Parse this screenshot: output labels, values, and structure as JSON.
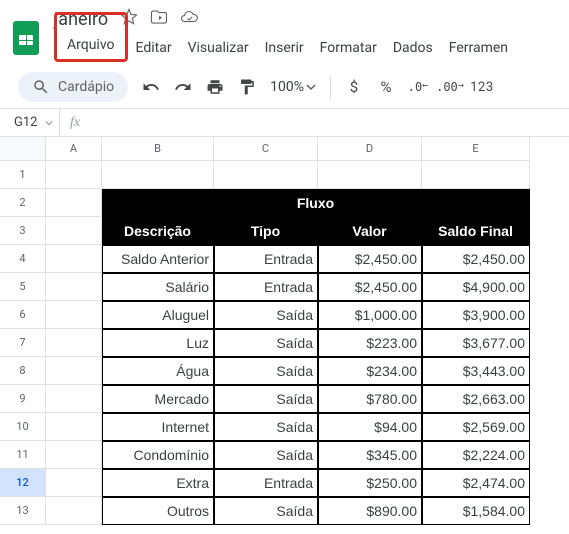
{
  "doc": {
    "title": "janeiro"
  },
  "menus": {
    "arquivo": "Arquivo",
    "editar": "Editar",
    "visualizar": "Visualizar",
    "inserir": "Inserir",
    "formatar": "Formatar",
    "dados": "Dados",
    "ferramentas": "Ferramen"
  },
  "toolbar": {
    "search": "Cardápio",
    "zoom": "100%",
    "currency": "$",
    "percent": "%",
    "dec_dec": ".0",
    "dec_inc": ".00",
    "num_fmt": "123"
  },
  "namebox": {
    "cell": "G12"
  },
  "columns": [
    "A",
    "B",
    "C",
    "D",
    "E"
  ],
  "rows": [
    "1",
    "2",
    "3",
    "4",
    "5",
    "6",
    "7",
    "8",
    "9",
    "10",
    "11",
    "12",
    "13"
  ],
  "selected_row": "12",
  "table": {
    "title": "Fluxo",
    "headers": {
      "desc": "Descrição",
      "tipo": "Tipo",
      "valor": "Valor",
      "saldo": "Saldo Final"
    },
    "rows": [
      {
        "desc": "Saldo Anterior",
        "tipo": "Entrada",
        "valor": "$2,450.00",
        "saldo": "$2,450.00"
      },
      {
        "desc": "Salário",
        "tipo": "Entrada",
        "valor": "$2,450.00",
        "saldo": "$4,900.00"
      },
      {
        "desc": "Aluguel",
        "tipo": "Saída",
        "valor": "$1,000.00",
        "saldo": "$3,900.00"
      },
      {
        "desc": "Luz",
        "tipo": "Saída",
        "valor": "$223.00",
        "saldo": "$3,677.00"
      },
      {
        "desc": "Água",
        "tipo": "Saída",
        "valor": "$234.00",
        "saldo": "$3,443.00"
      },
      {
        "desc": "Mercado",
        "tipo": "Saída",
        "valor": "$780.00",
        "saldo": "$2,663.00"
      },
      {
        "desc": "Internet",
        "tipo": "Saída",
        "valor": "$94.00",
        "saldo": "$2,569.00"
      },
      {
        "desc": "Condomínio",
        "tipo": "Saída",
        "valor": "$345.00",
        "saldo": "$2,224.00"
      },
      {
        "desc": "Extra",
        "tipo": "Entrada",
        "valor": "$250.00",
        "saldo": "$2,474.00"
      },
      {
        "desc": "Outros",
        "tipo": "Saída",
        "valor": "$890.00",
        "saldo": "$1,584.00"
      }
    ]
  }
}
